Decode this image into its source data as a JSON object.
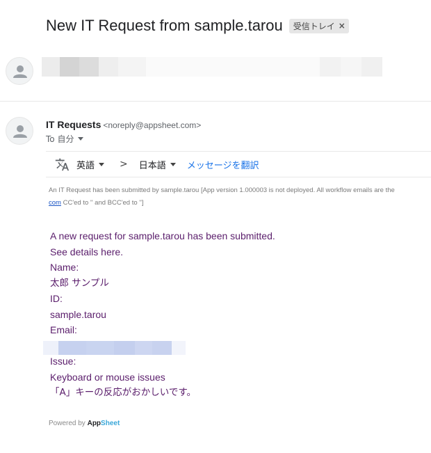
{
  "subject": "New IT Request from sample.tarou",
  "label_chip": {
    "text": "受信トレイ",
    "close": "×"
  },
  "sender": {
    "name": "IT Requests",
    "email": "<noreply@appsheet.com>"
  },
  "recipient": "To 自分",
  "translate": {
    "source_lang": "英語",
    "arrow": ">",
    "target_lang": "日本語",
    "action": "メッセージを翻訳"
  },
  "notice": {
    "line1": "An IT Request has been submitted by sample.tarou [App version 1.000003 is not deployed. All workflow emails are the",
    "line2_link": "com",
    "line2_rest": " CC'ed to '' and BCC'ed to '']"
  },
  "body": {
    "intro": "A new request for sample.tarou has been submitted.",
    "details": "See details here.",
    "name_label": "Name:",
    "name_value": "太郎 サンプル",
    "id_label": "ID:",
    "id_value": "sample.tarou",
    "email_label": "Email:",
    "issue_label": "Issue:",
    "issue_value": "Keyboard or mouse issues",
    "issue_detail": "「A」キーの反応がおかしいです。"
  },
  "footer": {
    "powered_by": "Powered by ",
    "brand_part1": "App",
    "brand_part2": "Sheet"
  }
}
